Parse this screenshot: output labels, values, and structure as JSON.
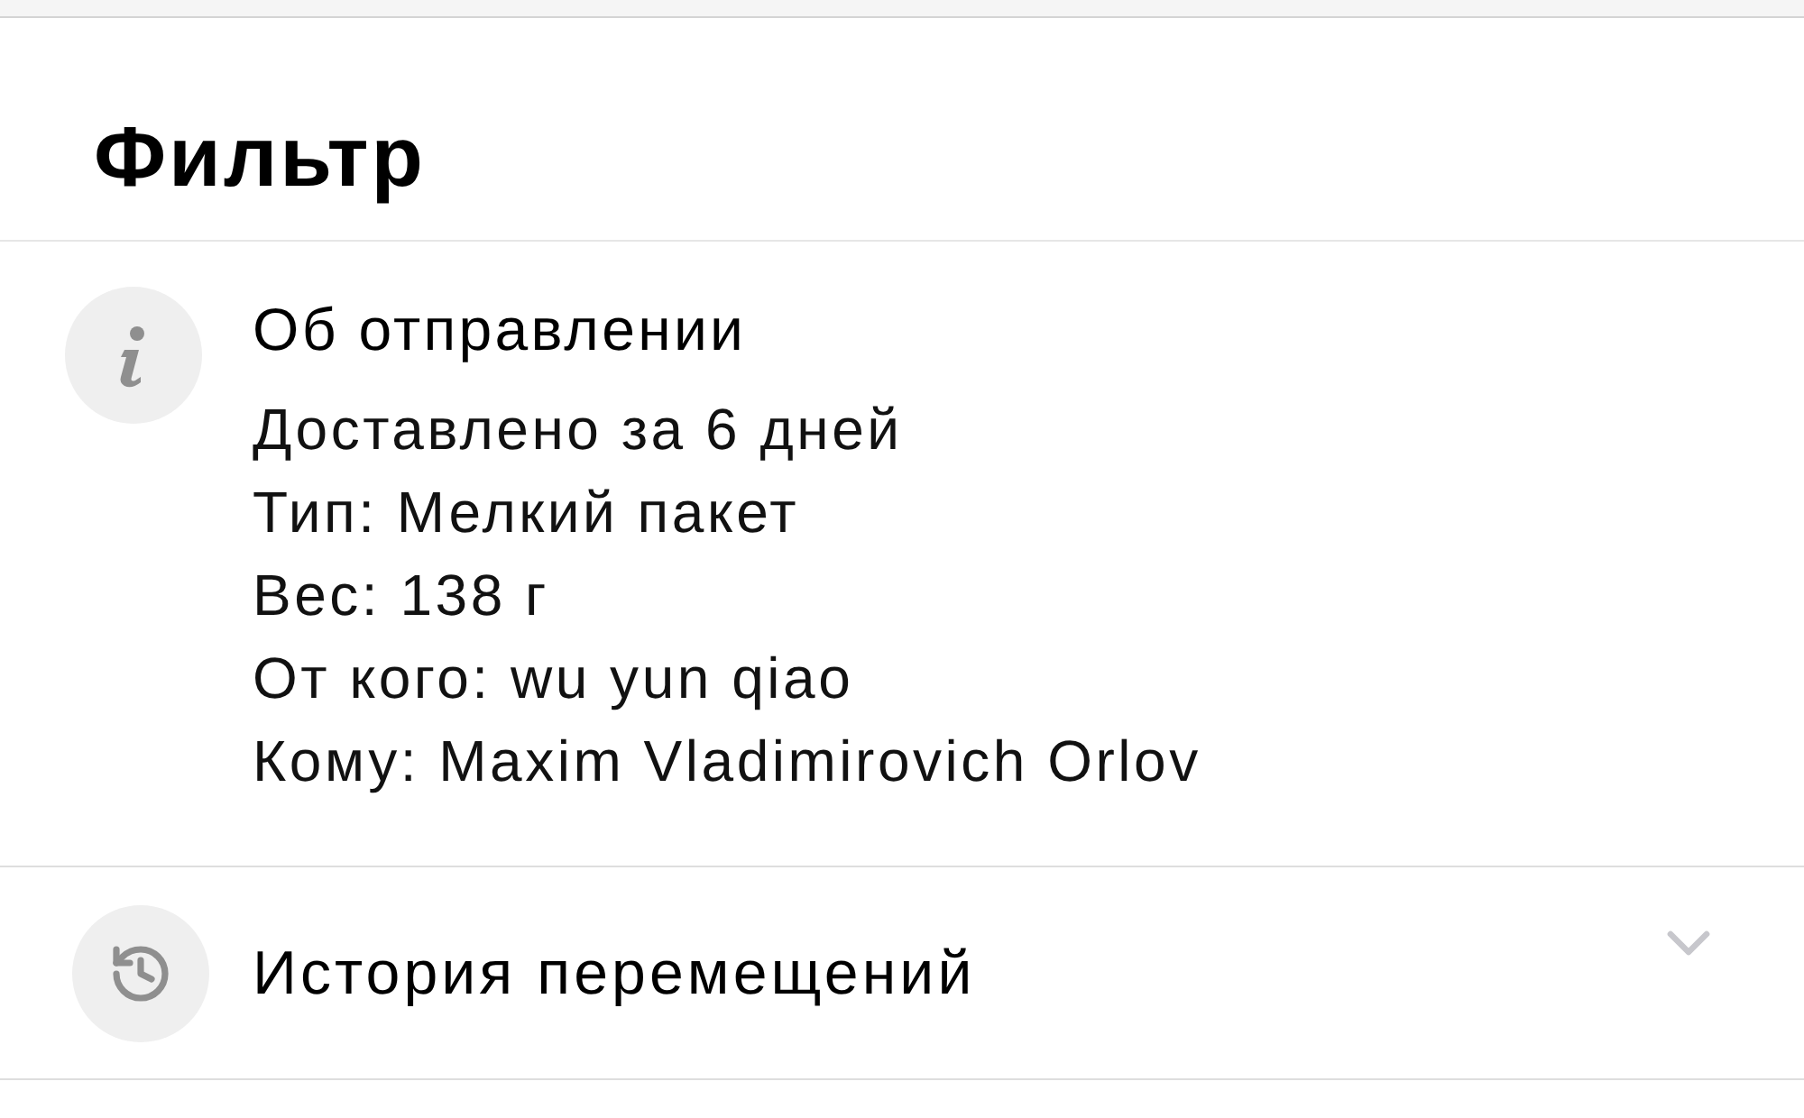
{
  "header": {
    "title": "Фильтр"
  },
  "sections": [
    {
      "kind": "info",
      "title": "Об отправлении",
      "lines": [
        "Доставлено за 6 дней",
        "Тип: Мелкий пакет",
        "Вес: 138 г",
        "От кого: wu yun qiao",
        "Кому: Maxim Vladimirovich Orlov"
      ]
    },
    {
      "kind": "history",
      "title": "История перемещений",
      "expanded": false
    }
  ]
}
